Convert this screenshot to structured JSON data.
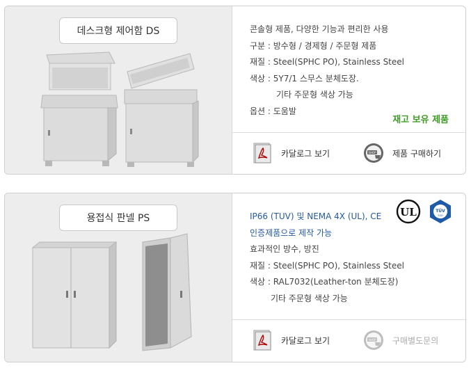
{
  "products": [
    {
      "title": "데스크형 제어함 DS",
      "lines": [
        "콘솔형 제품, 다양한 기능과 편리한 사용",
        "구분 :  방수형 / 경제형 / 주문형 제품",
        "재질 : Steel(SPHC PO), Stainless Steel",
        "색상 : 5Y7/1 스무스 분체도장.",
        "기타 주문형 색상 가능",
        "옵션 :  도움발"
      ],
      "stock_label": "재고 보유 제품",
      "catalog_label": "카달로그 보기",
      "action_label": "제품 구매하기",
      "shop_badge": "SHOP"
    },
    {
      "title": "용접식 판넬 PS",
      "lines": [
        "IP66 (TUV) 및 NEMA 4X (UL), CE",
        "인증제품으로 제작 가능",
        "효과적인 방수, 방진",
        "재질 : Steel(SPHC PO), Stainless Steel",
        "색상 : RAL7032(Leather-ton 분체도장)",
        "기타 주문형 색상 가능"
      ],
      "catalog_label": "카달로그 보기",
      "action_label": "구매별도문의",
      "shop_badge": "SHOP",
      "ul_mark": "UL",
      "tuv_mark": "TÜV",
      "tuv_sub": "SÜD"
    }
  ],
  "colors": {
    "stock_green": "#3f9b25",
    "cert_blue": "#245aa0",
    "tuv_blue": "#1f5aa8"
  }
}
